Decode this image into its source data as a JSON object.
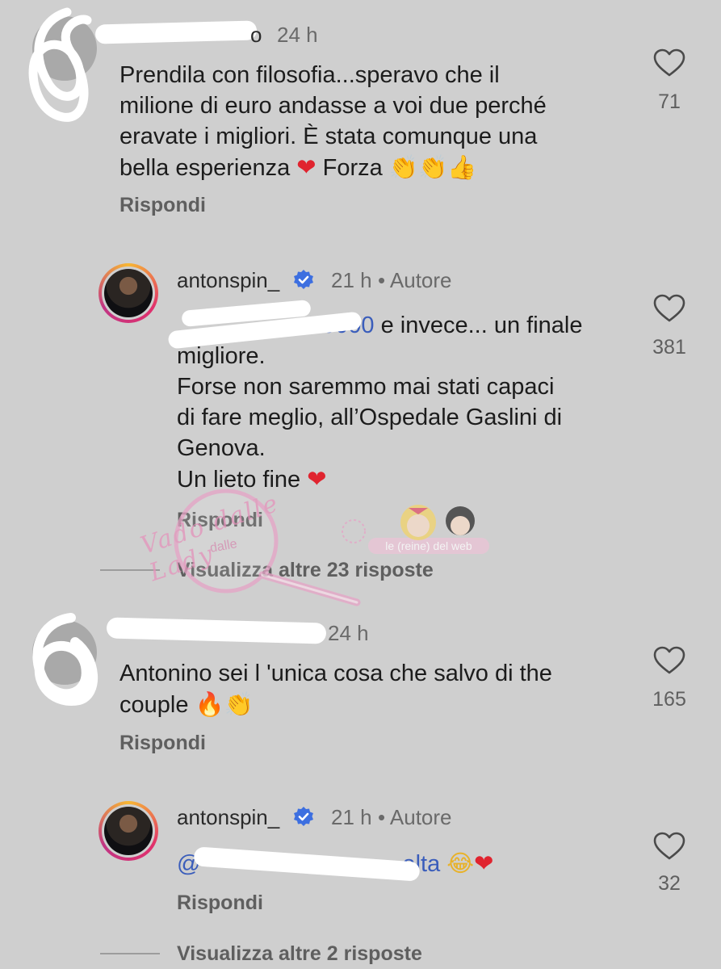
{
  "comments": [
    {
      "time": "24 h",
      "username_tail": "o",
      "text_lines": [
        "Prendila con filosofia...speravo che il",
        "milione di euro andasse a voi due perché",
        "eravate i migliori. È stata comunque una"
      ],
      "text_last": "bella esperienza",
      "text_forza": "Forza",
      "reply_label": "Rispondi",
      "like_count": "71"
    },
    {
      "username": "antonspin_",
      "time": "21 h",
      "author_tag": "• Autore",
      "mention_tail": "0000",
      "text_line1": "e invece... un finale",
      "text_lines": [
        "migliore.",
        "Forse non saremmo mai stati capaci",
        "di fare meglio, all’Ospedale Gaslini di",
        "Genova."
      ],
      "text_last": "Un lieto fine",
      "reply_label": "Rispondi",
      "like_count": "381",
      "view_more": "Visualizza altre 23 risposte"
    },
    {
      "time": "24 h",
      "text_lines": [
        "Antonino sei l 'unica cosa che salvo di the"
      ],
      "text_last": "couple",
      "reply_label": "Rispondi",
      "like_count": "165"
    },
    {
      "username": "antonspin_",
      "time": "21 h",
      "author_tag": "• Autore",
      "mention_head": "@",
      "mention_tail": "alta",
      "reply_label": "Rispondi",
      "like_count": "32",
      "view_more": "Visualizza altre 2 risposte"
    }
  ],
  "watermark": {
    "script_text": "Vado dalle Lady",
    "small_text": "dalle",
    "banner_text": "le (reine) del web"
  },
  "colors": {
    "background": "#cfcfcf",
    "mention": "#3a5dbb",
    "heart_red": "#e0242f",
    "verified_blue": "#3d6fe0",
    "redaction": "#ffffff"
  },
  "icons": {
    "like": "heart-outline-icon",
    "verified": "verified-badge-icon",
    "heart_emoji": "red-heart-emoji",
    "clap_emoji": "clapping-hands-emoji",
    "thumbs_emoji": "thumbs-up-emoji",
    "fire_emoji": "fire-emoji",
    "laugh_emoji": "tears-of-joy-emoji"
  }
}
